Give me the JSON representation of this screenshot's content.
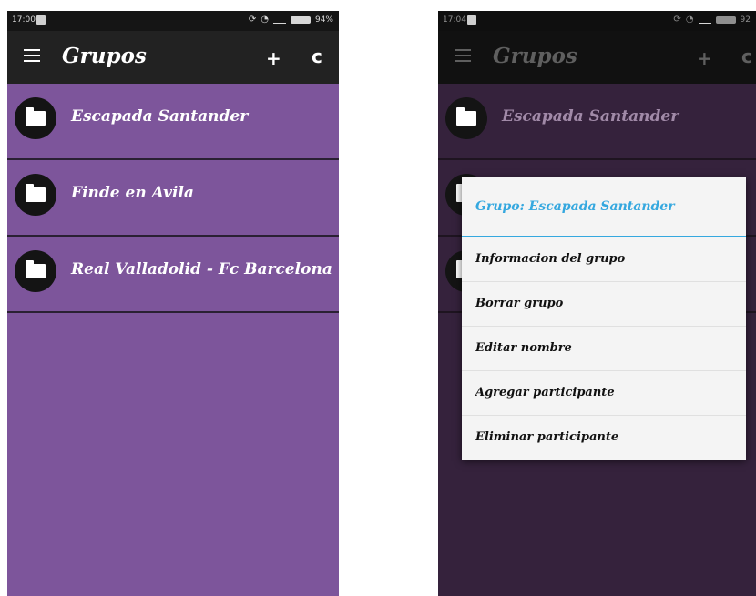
{
  "left": {
    "status": {
      "time": "17:00",
      "battery": "94%"
    },
    "appbar": {
      "title": "Grupos",
      "add": "+",
      "refresh": "c"
    },
    "groups": [
      "Escapada Santander",
      "Finde en Avila",
      "Real Valladolid - Fc Barcelona"
    ]
  },
  "right": {
    "status": {
      "time": "17:04",
      "battery": "92"
    },
    "appbar": {
      "title": "Grupos",
      "add": "+",
      "refresh": "c"
    },
    "groups": [
      "Escapada Santander"
    ],
    "dialog": {
      "title": "Grupo: Escapada Santander",
      "options": [
        "Informacion del grupo",
        "Borrar grupo",
        "Editar nombre",
        "Agregar participante",
        "Eliminar participante"
      ]
    }
  },
  "colors": {
    "list_bg": "#7d559b",
    "dim_bg": "#35223c",
    "appbar": "#222222",
    "accent": "#35a8df"
  }
}
